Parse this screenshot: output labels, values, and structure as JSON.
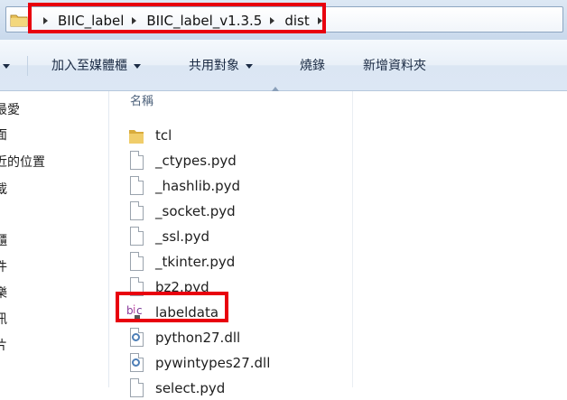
{
  "address_bar": {
    "crumbs": [
      "BIIC_label",
      "BIIC_label_v1.3.5",
      "dist"
    ]
  },
  "toolbar": {
    "add_to_library": "加入至媒體櫃",
    "share_with": "共用對象",
    "burn": "燒錄",
    "new_folder": "新增資料夾"
  },
  "nav": {
    "items": [
      "最愛",
      "面",
      "近的位置",
      "載",
      "櫃",
      "件",
      "樂",
      "訊",
      "片"
    ]
  },
  "file_list": {
    "column_name": "名稱",
    "files": [
      {
        "name": "tcl",
        "icon": "folder-icon"
      },
      {
        "name": "_ctypes.pyd",
        "icon": "file-icon"
      },
      {
        "name": "_hashlib.pyd",
        "icon": "file-icon"
      },
      {
        "name": "_socket.pyd",
        "icon": "file-icon"
      },
      {
        "name": "_ssl.pyd",
        "icon": "file-icon"
      },
      {
        "name": "_tkinter.pyd",
        "icon": "file-icon"
      },
      {
        "name": "bz2.pyd",
        "icon": "file-icon"
      },
      {
        "name": "labeldata",
        "icon": "biic-app-icon"
      },
      {
        "name": "python27.dll",
        "icon": "dll-icon"
      },
      {
        "name": "pywintypes27.dll",
        "icon": "dll-icon"
      },
      {
        "name": "select.pyd",
        "icon": "file-icon"
      }
    ]
  },
  "colors": {
    "highlight": "#e8000e",
    "folder": "#e8c15a"
  }
}
